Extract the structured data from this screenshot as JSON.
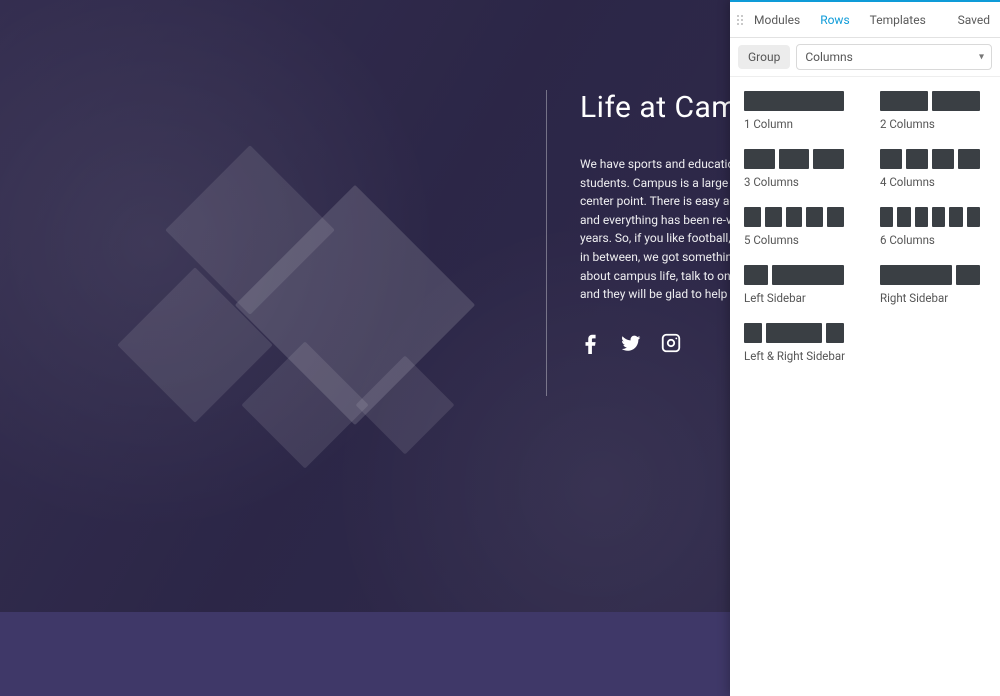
{
  "hero": {
    "title": "Life at Campus",
    "body": "We have sports and educational opportunities open to our students. Campus is a large area with a stadium being the center point. There is easy access to transportation and food, and everything has been re-vamped within the past couple of years. So, if you like football, soccer, theatre, music, or anything in between, we got something for you. If you want to know more about campus life, talk to one of our specially trained students and they will be glad to help you as much as they can."
  },
  "social": {
    "facebook": "facebook-icon",
    "twitter": "twitter-icon",
    "instagram": "instagram-icon"
  },
  "panel": {
    "tabs": {
      "modules": "Modules",
      "rows": "Rows",
      "templates": "Templates",
      "saved": "Saved"
    },
    "group_label": "Group",
    "select_value": "Columns",
    "layouts": {
      "col1": "1 Column",
      "col2": "2 Columns",
      "col3": "3 Columns",
      "col4": "4 Columns",
      "col5": "5 Columns",
      "col6": "6 Columns",
      "left_sidebar": "Left Sidebar",
      "right_sidebar": "Right Sidebar",
      "lr_sidebar": "Left & Right Sidebar"
    }
  }
}
